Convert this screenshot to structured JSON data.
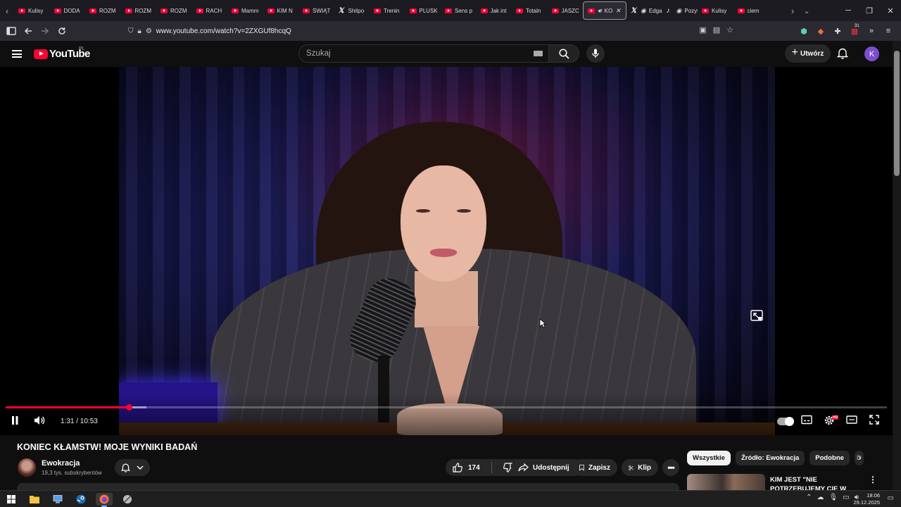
{
  "browser": {
    "tabs": [
      {
        "label": "Kulisy",
        "icon": "youtube"
      },
      {
        "label": "DODA",
        "icon": "youtube"
      },
      {
        "label": "ROZM",
        "icon": "youtube"
      },
      {
        "label": "ROZM",
        "icon": "youtube"
      },
      {
        "label": "ROZM",
        "icon": "youtube"
      },
      {
        "label": "RACH",
        "icon": "youtube"
      },
      {
        "label": "Mamm",
        "icon": "youtube"
      },
      {
        "label": "KIM N",
        "icon": "youtube"
      },
      {
        "label": "ŚWIĄT",
        "icon": "youtube"
      },
      {
        "label": "Shitpo",
        "icon": "x"
      },
      {
        "label": "Trenin",
        "icon": "youtube"
      },
      {
        "label": "PLUSK",
        "icon": "youtube"
      },
      {
        "label": "Sens p",
        "icon": "youtube"
      },
      {
        "label": "Jak int",
        "icon": "youtube"
      },
      {
        "label": "Totaln",
        "icon": "youtube"
      },
      {
        "label": "JASZC",
        "icon": "youtube"
      },
      {
        "label": "KO",
        "icon": "youtube",
        "active": true,
        "audio": true
      },
      {
        "label": "Edgar",
        "icon": "x-audio"
      },
      {
        "label": "Pozyty",
        "icon": "tiktok-audio"
      },
      {
        "label": "Kulisy",
        "icon": "youtube"
      },
      {
        "label": "ciem",
        "icon": "youtube"
      }
    ],
    "url": "www.youtube.com/watch?v=2ZXGUf8hcqQ",
    "extension_badge": "31"
  },
  "youtube": {
    "logo_text": "YouTube",
    "country_code": "PL",
    "search_placeholder": "Szukaj",
    "create_label": "Utwórz",
    "avatar_letter": "K"
  },
  "player": {
    "current_time": "1:31",
    "duration": "10:53",
    "time_display": "1:31 / 10:53",
    "played_fraction": 0.1395,
    "buffered_fraction": 0.16,
    "quality_badge": "HD"
  },
  "video": {
    "title": "KONIEC KŁAMSTW! MOJE WYNIKI BADAŃ",
    "channel_name": "Ewokracja",
    "subscribers": "19,3 tys. subskrybentów",
    "likes": "174",
    "share_label": "Udostępnij",
    "save_label": "Zapisz",
    "clip_label": "Klip"
  },
  "sidebar": {
    "chips": [
      "Wszystkie",
      "Źródło: Ewokracja",
      "Podobne",
      "D"
    ],
    "recommendation_title": "KIM JEST \"NIE POTRZEBUJEMY CIĘ W NASZYM SKŁADZIE\""
  },
  "taskbar": {
    "time": "18:06",
    "date": "29.12.2025"
  },
  "colors": {
    "youtube_red": "#ff0033",
    "background": "#0f0f0f",
    "chip_bg": "#272727",
    "avatar_purple": "#7c4dcc"
  }
}
